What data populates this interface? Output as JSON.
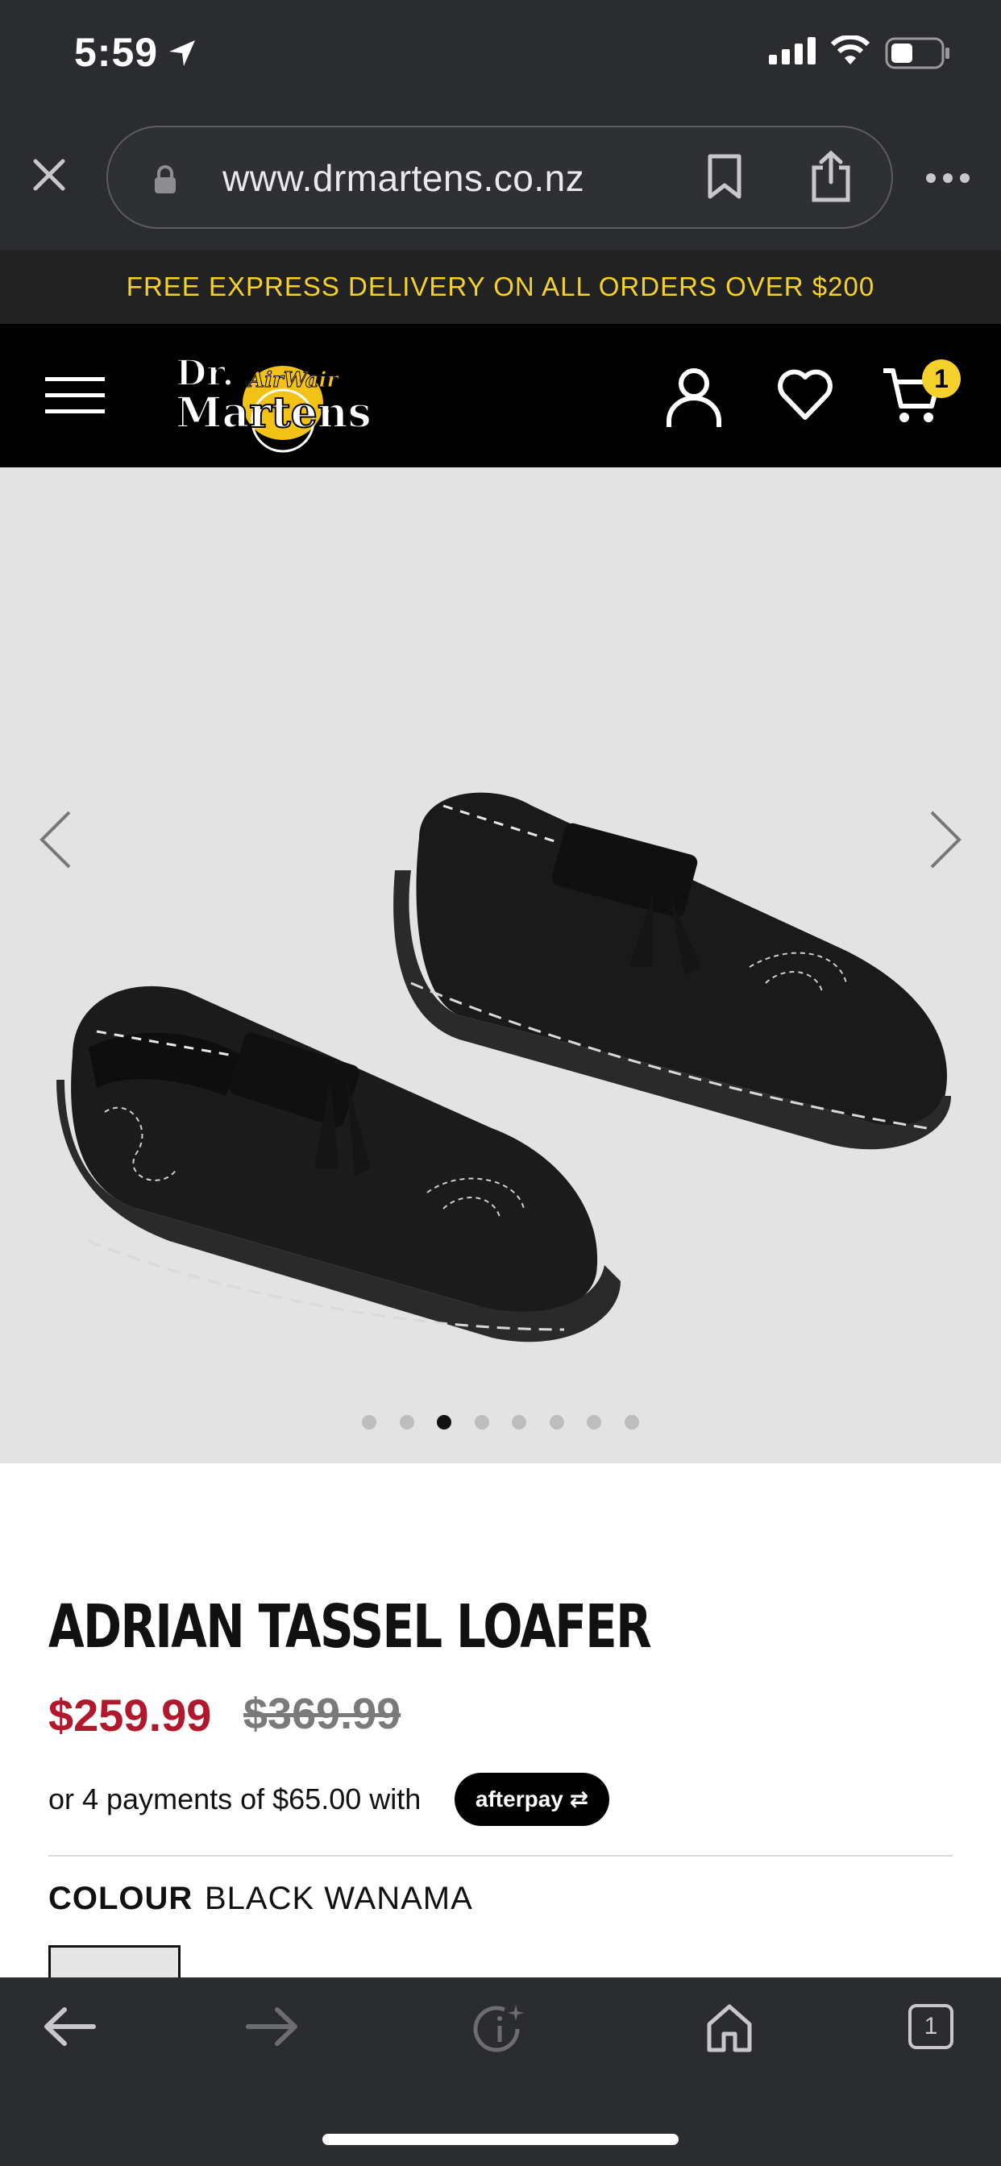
{
  "status_bar": {
    "time": "5:59"
  },
  "browser": {
    "url": "www.drmartens.co.nz"
  },
  "promo": {
    "text": "FREE EXPRESS DELIVERY ON ALL ORDERS OVER $200"
  },
  "header": {
    "logo_text": "Dr. Martens AirWair",
    "cart_count": "1"
  },
  "gallery": {
    "total_images": 8,
    "active_index": 2
  },
  "product": {
    "title": "ADRIAN TASSEL LOAFER",
    "sale_price": "$259.99",
    "original_price": "$369.99",
    "installments": "or 4 payments of $65.00 with",
    "afterpay": "afterpay",
    "colour_label": "COLOUR",
    "colour_value": "BLACK WANAMA"
  },
  "toolbar": {
    "tabs_count": "1"
  },
  "colors": {
    "promo_text": "#f5d22a",
    "sale_price": "#b2182b",
    "chrome": "#2b2c30"
  }
}
